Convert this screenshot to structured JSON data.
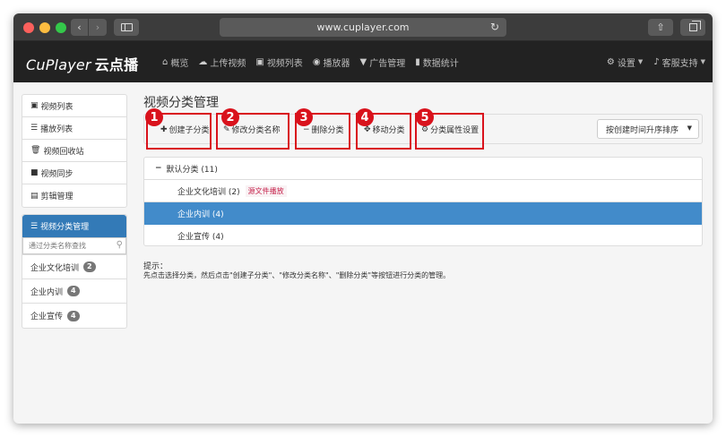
{
  "browser": {
    "url": "www.cuplayer.com"
  },
  "navbar": {
    "brand": "CuPlayer",
    "brand_cn": "云点播",
    "items": [
      {
        "label": "概览",
        "icon": "home-icon"
      },
      {
        "label": "上传视频",
        "icon": "upload-icon"
      },
      {
        "label": "视频列表",
        "icon": "film-icon"
      },
      {
        "label": "播放器",
        "icon": "play-circle-icon"
      },
      {
        "label": "广告管理",
        "icon": "filter-icon"
      },
      {
        "label": "数据统计",
        "icon": "bar-chart-icon"
      }
    ],
    "right_items": [
      {
        "label": "设置",
        "icon": "gear-icon"
      },
      {
        "label": "客服支持",
        "icon": "bell-icon"
      }
    ]
  },
  "sidebar": {
    "items": [
      {
        "label": "视频列表",
        "icon": "film-icon"
      },
      {
        "label": "播放列表",
        "icon": "list-icon"
      },
      {
        "label": "视频回收站",
        "icon": "trash-icon"
      },
      {
        "label": "视频同步",
        "icon": "video-sync-icon"
      },
      {
        "label": "剪辑管理",
        "icon": "scissors-icon"
      }
    ],
    "category_panel": {
      "title": "视频分类管理",
      "search_placeholder": "通过分类名称查找",
      "categories": [
        {
          "label": "企业文化培训",
          "count": "2"
        },
        {
          "label": "企业内训",
          "count": "4"
        },
        {
          "label": "企业宣传",
          "count": "4"
        }
      ]
    }
  },
  "main": {
    "title": "视频分类管理",
    "toolbar": {
      "buttons": [
        {
          "number": "1",
          "label": "创建子分类",
          "icon": "plus-icon"
        },
        {
          "number": "2",
          "label": "修改分类名称",
          "icon": "pencil-icon"
        },
        {
          "number": "3",
          "label": "删除分类",
          "icon": "minus-icon"
        },
        {
          "number": "4",
          "label": "移动分类",
          "icon": "move-icon"
        },
        {
          "number": "5",
          "label": "分类属性设置",
          "icon": "gear-icon"
        }
      ],
      "sort_label": "按创建时间升序排序"
    },
    "tree": {
      "root": "默认分类 (11)",
      "children": [
        {
          "label": "企业文化培训 (2)",
          "tag": "源文件播放"
        },
        {
          "label": "企业内训 (4)",
          "selected": true
        },
        {
          "label": "企业宣传 (4)"
        }
      ]
    },
    "hint": {
      "title": "提示：",
      "text": "先点击选择分类，然后点击\"创建子分类\"、\"修改分类名称\"、\"删除分类\"等按钮进行分类的管理。"
    }
  },
  "colors": {
    "navbar_bg": "#222222",
    "primary": "#337ab7",
    "selected_row": "#428bca",
    "highlight_red": "#d9121c"
  }
}
